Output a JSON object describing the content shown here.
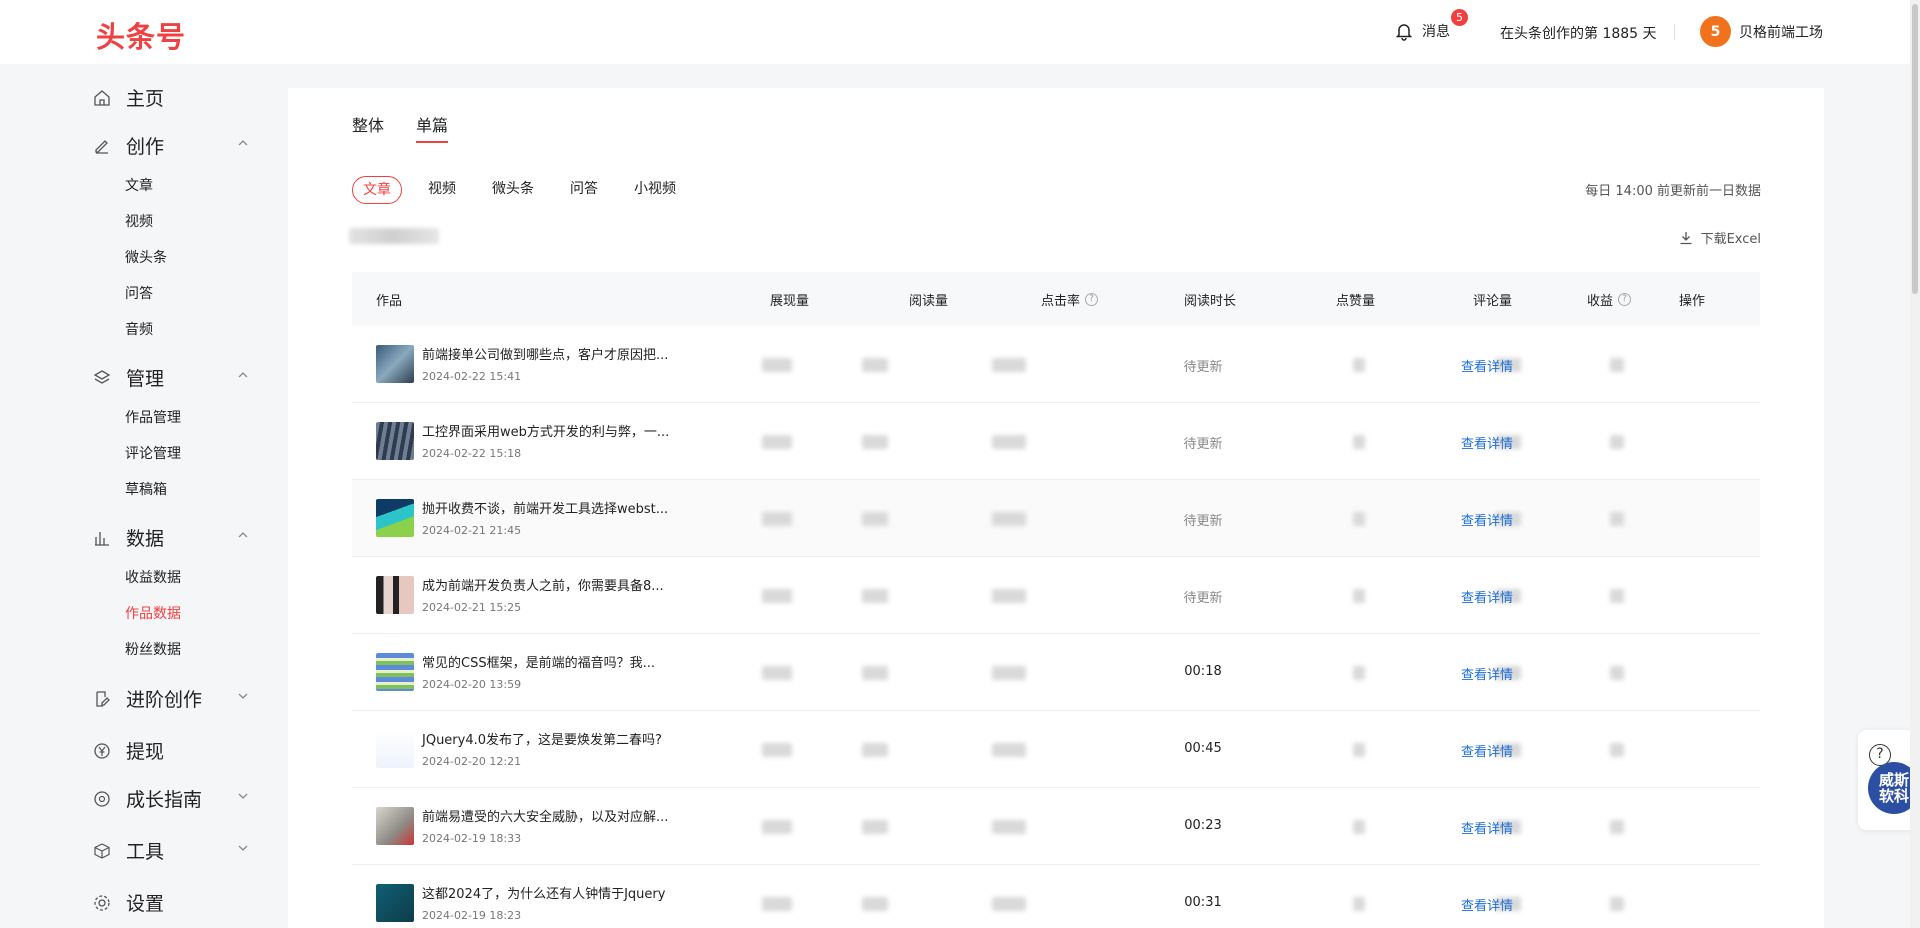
{
  "header": {
    "logo": "头条号",
    "messages_label": "消息",
    "messages_badge": "5",
    "days_text": "在头条创作的第 1885 天",
    "username": "贝格前端工场",
    "avatar_glyph": "5"
  },
  "sidebar": {
    "home": "主页",
    "create": "创作",
    "create_items": [
      "文章",
      "视频",
      "微头条",
      "问答",
      "音频"
    ],
    "manage": "管理",
    "manage_items": [
      "作品管理",
      "评论管理",
      "草稿箱"
    ],
    "data": "数据",
    "data_items": [
      "收益数据",
      "作品数据",
      "粉丝数据"
    ],
    "advanced": "进阶创作",
    "withdraw": "提现",
    "growth": "成长指南",
    "tools": "工具",
    "settings": "设置"
  },
  "main": {
    "tab_overall": "整体",
    "tab_single": "单篇",
    "chips": [
      "文章",
      "视频",
      "微头条",
      "问答",
      "小视频"
    ],
    "update_note": "每日 14:00 前更新前一日数据",
    "download": "下载Excel",
    "columns": [
      "作品",
      "展现量",
      "阅读量",
      "点击率",
      "阅读时长",
      "点赞量",
      "评论量",
      "收益",
      "操作"
    ],
    "detail_label": "查看详情",
    "rows": [
      {
        "title": "前端接单公司做到哪些点，客户才原因把...",
        "date": "2024-02-22 15:41",
        "duration": "待更新"
      },
      {
        "title": "工控界面采用web方式开发的利与弊，一...",
        "date": "2024-02-22 15:18",
        "duration": "待更新"
      },
      {
        "title": "抛开收费不谈，前端开发工具选择webst...",
        "date": "2024-02-21 21:45",
        "duration": "待更新"
      },
      {
        "title": "成为前端开发负责人之前，你需要具备8...",
        "date": "2024-02-21 15:25",
        "duration": "待更新"
      },
      {
        "title": "常见的CSS框架，是前端的福音吗？我...",
        "date": "2024-02-20 13:59",
        "duration": "00:18"
      },
      {
        "title": "JQuery4.0发布了，这是要焕发第二春吗?",
        "date": "2024-02-20 12:21",
        "duration": "00:45"
      },
      {
        "title": "前端易遭受的六大安全威胁，以及对应解...",
        "date": "2024-02-19 18:33",
        "duration": "00:23"
      },
      {
        "title": "这都2024了，为什么还有人钟情于Jquery",
        "date": "2024-02-19 18:23",
        "duration": "00:31"
      }
    ]
  },
  "widgets": {
    "help_glyph": "?",
    "watermark": "威斯\n软科"
  },
  "colors": {
    "brand_red": "#f04142",
    "link_blue": "#1d6ed8"
  }
}
